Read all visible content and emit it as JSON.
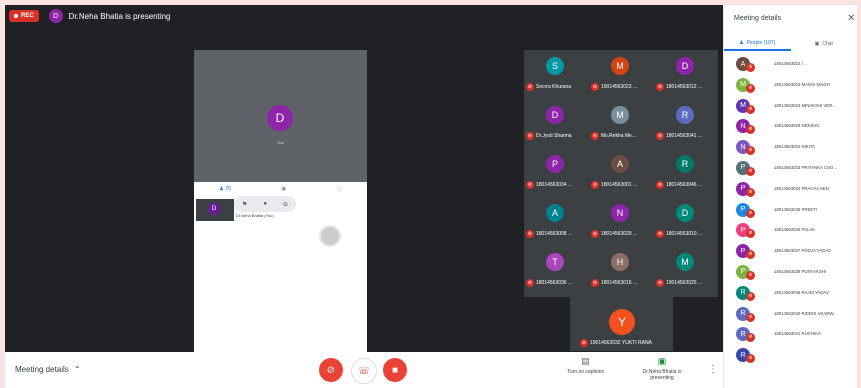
{
  "topbar": {
    "rec_label": "REC",
    "presenter_initial": "D",
    "presenter_text": "Dr.Neha Bhatia is presenting"
  },
  "presentation": {
    "avatar_initial": "D",
    "name_caption": "You",
    "people_count": "70",
    "tile_initial": "D",
    "tile_name": "Dr.Neha Bhatia (You)"
  },
  "grid": [
    {
      "initial": "S",
      "name": "Socrra Khurana",
      "color": "#0097a7"
    },
    {
      "initial": "M",
      "name": "19014563023 ...",
      "color": "#d84315"
    },
    {
      "initial": "D",
      "name": "18014563012 ...",
      "color": "#8e24aa"
    },
    {
      "initial": "D",
      "name": "Dr.Jyoti Sharma",
      "color": "#8e24aa"
    },
    {
      "initial": "M",
      "name": "Ms.Rekha Me...",
      "color": "#78909c"
    },
    {
      "initial": "R",
      "name": "18014563041 ...",
      "color": "#5c6bc0"
    },
    {
      "initial": "P",
      "name": "18014563034 ...",
      "color": "#8e24aa"
    },
    {
      "initial": "A",
      "name": "18014563001 ...",
      "color": "#6d4c41"
    },
    {
      "initial": "R",
      "name": "18014563046 ...",
      "color": "#00796b"
    },
    {
      "initial": "A",
      "name": "18014563008 ...",
      "color": "#00838f"
    },
    {
      "initial": "N",
      "name": "18014563029 ...",
      "color": "#8e24aa"
    },
    {
      "initial": "D",
      "name": "18014563010 ...",
      "color": "#00897b"
    },
    {
      "initial": "T",
      "name": "18014563036 ...",
      "color": "#ab47bc"
    },
    {
      "initial": "H",
      "name": "18014563016 ...",
      "color": "#8d6e63"
    },
    {
      "initial": "M",
      "name": "19014563025 ...",
      "color": "#00897b"
    }
  ],
  "self_tile": {
    "initial": "Y",
    "name": "19014563032 YUKTI RANA"
  },
  "bottombar": {
    "meeting_details": "Meeting details",
    "captions_label": "Turn on captions",
    "presenting_label": "Dr.Neha Bhatia is presenting"
  },
  "panel": {
    "title": "Meeting details",
    "people_tab": "People (107)",
    "chat_tab": "Chat",
    "people": [
      {
        "initial": "A",
        "name": "18014563022 / ...",
        "color": "#6d4c41"
      },
      {
        "initial": "M",
        "name": "18014563023 MANSI SINGH",
        "color": "#7cb342"
      },
      {
        "initial": "M",
        "name": "18014563024 MINAKSHI VER...",
        "color": "#5e35b1"
      },
      {
        "initial": "N",
        "name": "18014563029 NEESHU",
        "color": "#8e24aa"
      },
      {
        "initial": "N",
        "name": "18014563032 NIKITA",
        "color": "#7e57c2"
      },
      {
        "initial": "P",
        "name": "18014563033 PRIYANKA CHO...",
        "color": "#546e7a"
      },
      {
        "initial": "P",
        "name": "18014563034 PRAGYA SEN",
        "color": "#8e24aa"
      },
      {
        "initial": "P",
        "name": "18014563035 PREETI",
        "color": "#1e88e5"
      },
      {
        "initial": "P",
        "name": "18014563036 PALAK",
        "color": "#ec407a"
      },
      {
        "initial": "P",
        "name": "18014563037 POOJA YADAV",
        "color": "#8e24aa"
      },
      {
        "initial": "P",
        "name": "18014563038 PUNYAKSHI",
        "color": "#7cb342"
      },
      {
        "initial": "R",
        "name": "18014563039 RAJNI YADAV",
        "color": "#00897b"
      },
      {
        "initial": "R",
        "name": "18014563040 RIDDHI AGARW...",
        "color": "#5c6bc0"
      },
      {
        "initial": "R",
        "name": "18014563041 RUCHIKA",
        "color": "#5c6bc0"
      },
      {
        "initial": "R",
        "name": "",
        "color": "#3949ab"
      }
    ]
  }
}
